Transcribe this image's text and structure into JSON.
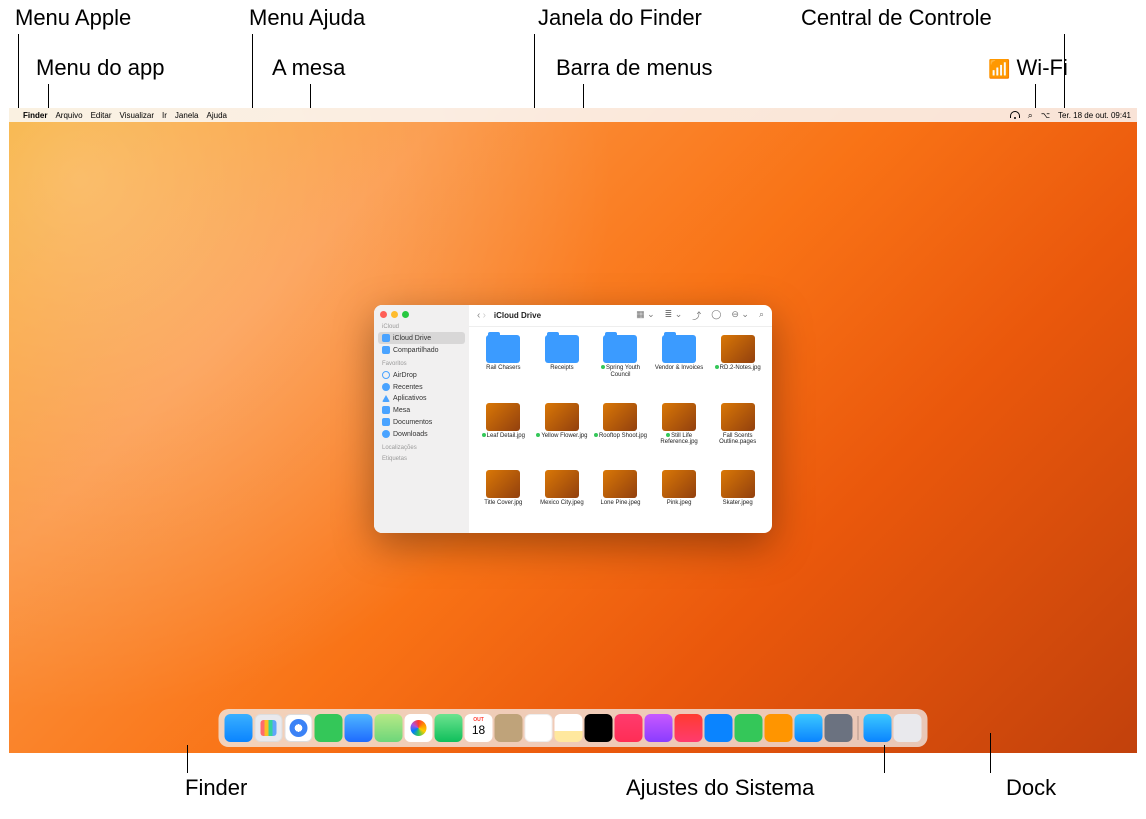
{
  "callouts": {
    "apple_menu": "Menu Apple",
    "app_menu": "Menu do app",
    "help_menu": "Menu Ajuda",
    "desktop": "A mesa",
    "finder_window": "Janela do Finder",
    "menu_bar": "Barra de menus",
    "control_center": "Central de Controle",
    "wifi": "Wi-Fi",
    "finder_dock": "Finder",
    "system_settings": "Ajustes do Sistema",
    "dock": "Dock"
  },
  "menubar": {
    "apple_glyph": "",
    "app_name": "Finder",
    "items": [
      "Arquivo",
      "Editar",
      "Visualizar",
      "Ir",
      "Janela",
      "Ajuda"
    ],
    "status": {
      "wifi": "wifi-icon",
      "spotlight": "search-icon",
      "control_center": "cc-icon",
      "datetime": "Ter. 18 de out.  09:41"
    }
  },
  "finder": {
    "title": "iCloud Drive",
    "sidebar": {
      "sections": [
        {
          "header": "iCloud",
          "items": [
            {
              "label": "iCloud Drive",
              "icon": "ico-cloud",
              "active": true
            },
            {
              "label": "Compartilhado",
              "icon": "ico-share"
            }
          ]
        },
        {
          "header": "Favoritos",
          "items": [
            {
              "label": "AirDrop",
              "icon": "ico-airdrop"
            },
            {
              "label": "Recentes",
              "icon": "ico-recent"
            },
            {
              "label": "Aplicativos",
              "icon": "ico-apps"
            },
            {
              "label": "Mesa",
              "icon": "ico-desk"
            },
            {
              "label": "Documentos",
              "icon": "ico-docs"
            },
            {
              "label": "Downloads",
              "icon": "ico-down"
            }
          ]
        },
        {
          "header": "Localizações",
          "items": []
        },
        {
          "header": "Etiquetas",
          "items": []
        }
      ]
    },
    "items": [
      {
        "name": "Rail Chasers",
        "type": "folder"
      },
      {
        "name": "Receipts",
        "type": "folder"
      },
      {
        "name": "Spring Youth Council",
        "type": "folder",
        "tag": true
      },
      {
        "name": "Vendor & Invoices",
        "type": "folder"
      },
      {
        "name": "RD.2-Notes.jpg",
        "type": "image",
        "tag": true
      },
      {
        "name": "Leaf Detail.jpg",
        "type": "image",
        "tag": true
      },
      {
        "name": "Yellow Flower.jpg",
        "type": "image",
        "tag": true
      },
      {
        "name": "Rooftop Shoot.jpg",
        "type": "image",
        "tag": true
      },
      {
        "name": "Still Life Reference.jpg",
        "type": "image",
        "tag": true
      },
      {
        "name": "Fall Scents Outline.pages",
        "type": "image"
      },
      {
        "name": "Title Cover.jpg",
        "type": "image"
      },
      {
        "name": "Mexico City.jpeg",
        "type": "image"
      },
      {
        "name": "Lone Pine.jpeg",
        "type": "image"
      },
      {
        "name": "Pink.jpeg",
        "type": "image"
      },
      {
        "name": "Skater.jpeg",
        "type": "image"
      }
    ]
  },
  "calendar": {
    "month": "OUT",
    "day": "18"
  },
  "dock": {
    "apps": [
      {
        "id": "finder",
        "cls": "d-finder"
      },
      {
        "id": "launchpad",
        "cls": "d-launch"
      },
      {
        "id": "safari",
        "cls": "d-safari"
      },
      {
        "id": "messages",
        "cls": "d-msg"
      },
      {
        "id": "mail",
        "cls": "d-mail"
      },
      {
        "id": "maps",
        "cls": "d-maps"
      },
      {
        "id": "photos",
        "cls": "d-photos"
      },
      {
        "id": "facetime",
        "cls": "d-ft"
      },
      {
        "id": "calendar",
        "cls": "d-cal"
      },
      {
        "id": "contacts",
        "cls": "d-contacts"
      },
      {
        "id": "reminders",
        "cls": "d-reminders"
      },
      {
        "id": "notes",
        "cls": "d-notes"
      },
      {
        "id": "tv",
        "cls": "d-tv"
      },
      {
        "id": "music",
        "cls": "d-music"
      },
      {
        "id": "podcasts",
        "cls": "d-podcast"
      },
      {
        "id": "news",
        "cls": "d-news"
      },
      {
        "id": "keynote",
        "cls": "d-keynote"
      },
      {
        "id": "numbers",
        "cls": "d-numbers"
      },
      {
        "id": "pages",
        "cls": "d-pages"
      },
      {
        "id": "appstore",
        "cls": "d-store"
      },
      {
        "id": "system-settings",
        "cls": "d-settings"
      }
    ],
    "right": [
      {
        "id": "downloads",
        "cls": "d-dl"
      },
      {
        "id": "trash",
        "cls": "d-trash"
      }
    ]
  }
}
